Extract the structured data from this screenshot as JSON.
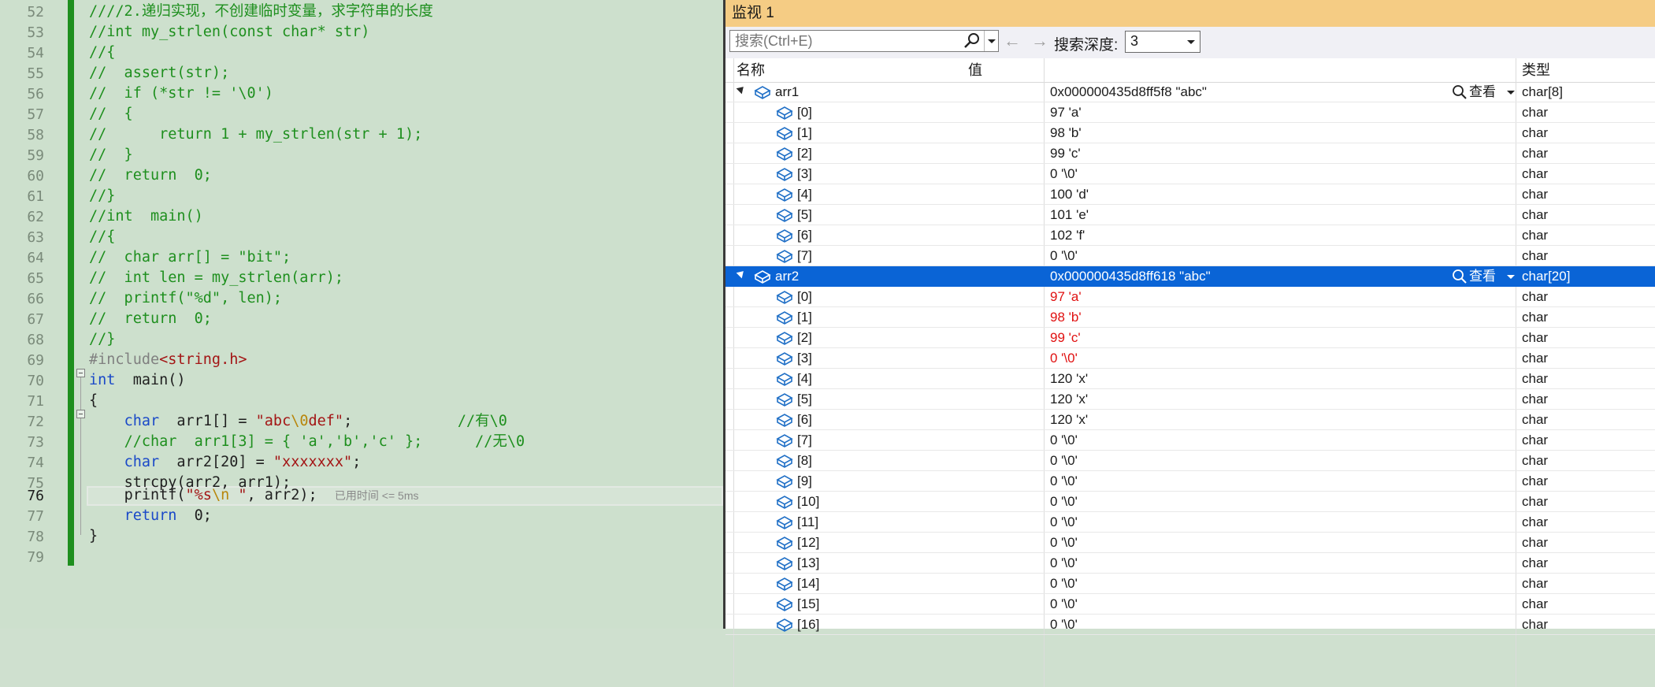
{
  "editor": {
    "line_numbers": [
      "52",
      "53",
      "54",
      "55",
      "56",
      "57",
      "58",
      "59",
      "60",
      "61",
      "62",
      "63",
      "64",
      "65",
      "66",
      "67",
      "68",
      "69",
      "70",
      "71",
      "72",
      "73",
      "74",
      "75",
      "76",
      "77",
      "78",
      "79"
    ],
    "current_line": "76",
    "lines": {
      "l52": "////2.递归实现，不创建临时变量，求字符串的长度",
      "l53": "//int my_strlen(const char* str)",
      "l54": "//{",
      "l55": "//  assert(str);",
      "l56": "//  if (*str != '\\0')",
      "l57": "//  {",
      "l58": "//      return 1 + my_strlen(str + 1);",
      "l59": "//  }",
      "l60": "//  return  0;",
      "l61": "//}",
      "l62": "//int  main()",
      "l63": "//{",
      "l64": "//  char arr[] = \"bit\";",
      "l65": "//  int len = my_strlen(arr);",
      "l66": "//  printf(\"%d\", len);",
      "l67": "//  return  0;",
      "l68": "//}",
      "l69_pre": "#include",
      "l69_hdr": "<string.h>",
      "l70_kw": "int",
      "l70_rest": "  main()",
      "l71": "{",
      "l72_kw": "char",
      "l72_a": "  arr1[] = ",
      "l72_s1": "\"abc",
      "l72_esc": "\\0",
      "l72_s2": "def\"",
      "l72_b": ";",
      "l72_com": "//有\\0",
      "l73": "//char  arr1[3] = { 'a','b','c' };",
      "l73_com": "//无\\0",
      "l74_kw": "char",
      "l74_a": "  arr2[20] = ",
      "l74_str": "\"xxxxxxx\"",
      "l74_b": ";",
      "l75": "strcpy(arr2, arr1);",
      "l76_a": "printf(",
      "l76_s1": "\"%s",
      "l76_esc": "\\n",
      "l76_s2": " \"",
      "l76_b": ", arr2);",
      "l76_elapsed": "已用时间 <= 5ms",
      "l77_kw": "return",
      "l77_rest": "  0;",
      "l78": "}"
    }
  },
  "watch": {
    "title": "监视 1",
    "search_placeholder": "搜索(Ctrl+E)",
    "depth_label": "搜索深度:",
    "depth_value": "3",
    "nav_back": "←",
    "nav_fwd": "→",
    "headers": {
      "name": "名称",
      "value": "值",
      "type": "类型"
    },
    "view_label": "查看",
    "rows": [
      {
        "name": "arr1",
        "value": "0x000000435d8ff5f8 \"abc\"",
        "type": "char[8]"
      },
      {
        "name": "[0]",
        "value": "97 'a'",
        "type": "char"
      },
      {
        "name": "[1]",
        "value": "98 'b'",
        "type": "char"
      },
      {
        "name": "[2]",
        "value": "99 'c'",
        "type": "char"
      },
      {
        "name": "[3]",
        "value": "0 '\\0'",
        "type": "char"
      },
      {
        "name": "[4]",
        "value": "100 'd'",
        "type": "char"
      },
      {
        "name": "[5]",
        "value": "101 'e'",
        "type": "char"
      },
      {
        "name": "[6]",
        "value": "102 'f'",
        "type": "char"
      },
      {
        "name": "[7]",
        "value": "0 '\\0'",
        "type": "char"
      },
      {
        "name": "arr2",
        "value": "0x000000435d8ff618 \"abc\"",
        "type": "char[20]"
      },
      {
        "name": "[0]",
        "value": "97 'a'",
        "type": "char"
      },
      {
        "name": "[1]",
        "value": "98 'b'",
        "type": "char"
      },
      {
        "name": "[2]",
        "value": "99 'c'",
        "type": "char"
      },
      {
        "name": "[3]",
        "value": "0 '\\0'",
        "type": "char"
      },
      {
        "name": "[4]",
        "value": "120 'x'",
        "type": "char"
      },
      {
        "name": "[5]",
        "value": "120 'x'",
        "type": "char"
      },
      {
        "name": "[6]",
        "value": "120 'x'",
        "type": "char"
      },
      {
        "name": "[7]",
        "value": "0 '\\0'",
        "type": "char"
      },
      {
        "name": "[8]",
        "value": "0 '\\0'",
        "type": "char"
      },
      {
        "name": "[9]",
        "value": "0 '\\0'",
        "type": "char"
      },
      {
        "name": "[10]",
        "value": "0 '\\0'",
        "type": "char"
      },
      {
        "name": "[11]",
        "value": "0 '\\0'",
        "type": "char"
      },
      {
        "name": "[12]",
        "value": "0 '\\0'",
        "type": "char"
      },
      {
        "name": "[13]",
        "value": "0 '\\0'",
        "type": "char"
      },
      {
        "name": "[14]",
        "value": "0 '\\0'",
        "type": "char"
      },
      {
        "name": "[15]",
        "value": "0 '\\0'",
        "type": "char"
      },
      {
        "name": "[16]",
        "value": "0 '\\0'",
        "type": "char"
      }
    ]
  },
  "colors": {
    "editor_bg": "#cde0cd",
    "comment": "#1e8f1e",
    "keyword": "#1a49c8",
    "string": "#a31515",
    "changed_value": "#e01010",
    "selection": "#0a64d6",
    "title_bar": "#f5cc84"
  }
}
